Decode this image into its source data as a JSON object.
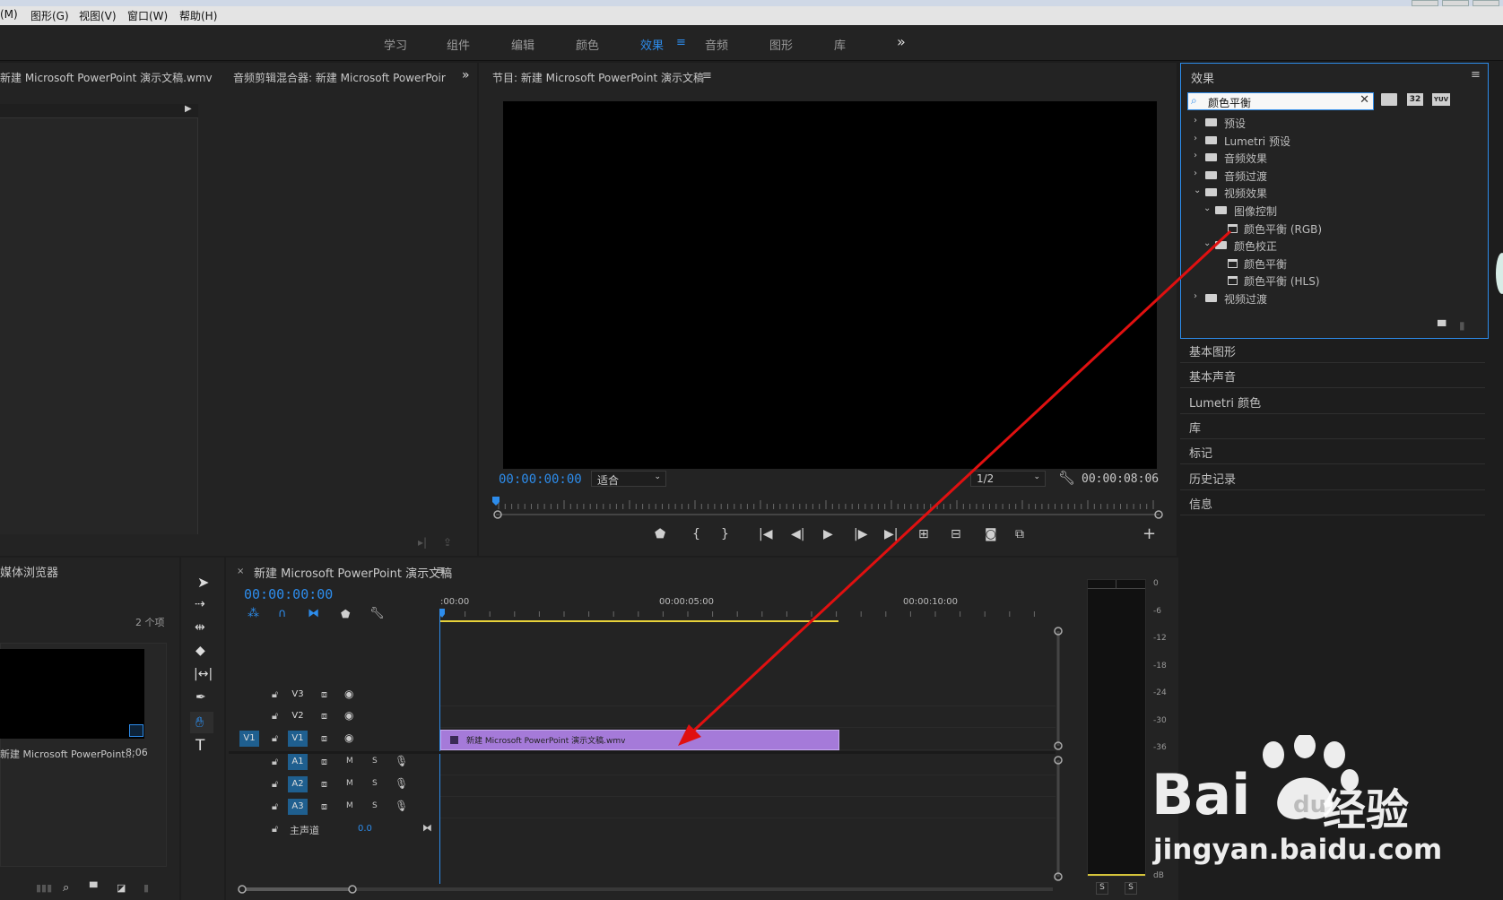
{
  "menu": {
    "items": [
      "(M)",
      "图形(G)",
      "视图(V)",
      "窗口(W)",
      "帮助(H)"
    ]
  },
  "workspaces": {
    "tabs": [
      "学习",
      "组件",
      "编辑",
      "颜色",
      "效果",
      "音频",
      "图形",
      "库"
    ],
    "active": "效果",
    "more": "»"
  },
  "source_panel": {
    "title": "新建 Microsoft PowerPoint 演示文稿.wmv"
  },
  "audio_mixer": {
    "title": "音频剪辑混合器: 新建 Microsoft PowerPoir"
  },
  "program": {
    "title": "节目: 新建 Microsoft PowerPoint 演示文稿",
    "timecode": "00:00:00:00",
    "fit": "适合",
    "resolution": "1/2",
    "duration": "00:00:08:06"
  },
  "effects": {
    "title": "效果",
    "search_value": "颜色平衡",
    "tree": [
      {
        "label": "预设",
        "level": 0,
        "kind": "preset",
        "open": false
      },
      {
        "label": "Lumetri 预设",
        "level": 0,
        "kind": "preset",
        "open": false
      },
      {
        "label": "音频效果",
        "level": 0,
        "kind": "folder",
        "open": false
      },
      {
        "label": "音频过渡",
        "level": 0,
        "kind": "folder",
        "open": false
      },
      {
        "label": "视频效果",
        "level": 0,
        "kind": "folder",
        "open": true
      },
      {
        "label": "图像控制",
        "level": 1,
        "kind": "folder",
        "open": true
      },
      {
        "label": "颜色平衡 (RGB)",
        "level": 2,
        "kind": "effect"
      },
      {
        "label": "颜色校正",
        "level": 1,
        "kind": "folder",
        "open": true
      },
      {
        "label": "颜色平衡",
        "level": 2,
        "kind": "effect"
      },
      {
        "label": "颜色平衡 (HLS)",
        "level": 2,
        "kind": "effect"
      },
      {
        "label": "视频过渡",
        "level": 0,
        "kind": "folder",
        "open": false
      }
    ],
    "badge_32": "32",
    "badge_yuv": "YUV"
  },
  "side_panels": [
    "基本图形",
    "基本声音",
    "Lumetri 颜色",
    "库",
    "标记",
    "历史记录",
    "信息"
  ],
  "project": {
    "title": "媒体浏览器",
    "count": "2 个项",
    "clip_name": "新建 Microsoft PowerPoint...",
    "clip_duration": "8:06"
  },
  "timeline": {
    "title": "新建 Microsoft PowerPoint 演示文稿",
    "timecode": "00:00:00:00",
    "ruler": [
      ":00:00",
      "00:00:05:00",
      "00:00:10:00"
    ],
    "video_tracks": [
      "V3",
      "V2",
      "V1"
    ],
    "audio_tracks": [
      "A1",
      "A2",
      "A3"
    ],
    "source_patch": "V1",
    "master_label": "主声道",
    "master_value": "0.0",
    "mute": "M",
    "solo": "S",
    "clip_label": "新建 Microsoft PowerPoint 演示文稿.wmv"
  },
  "meter": {
    "ticks": [
      "0",
      "-6",
      "-12",
      "-18",
      "-24",
      "-30",
      "-36"
    ],
    "unit": "dB",
    "solo_left": "S",
    "solo_right": "S"
  },
  "watermark": {
    "line1": "Bai",
    "line2": "经验",
    "url": "jingyan.baidu.com"
  },
  "colors": {
    "accent": "#2d8ceb",
    "clip": "#a57ad9",
    "annotation": "#e01010"
  }
}
